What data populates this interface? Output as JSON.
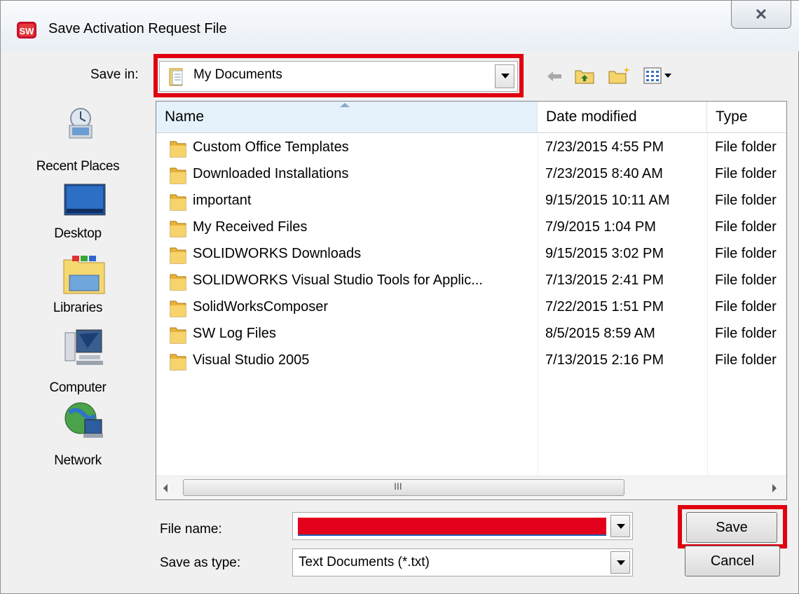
{
  "window": {
    "title": "Save Activation Request File",
    "app_icon": "solidworks-icon",
    "close_glyph": "✕"
  },
  "save_in": {
    "label": "Save in:",
    "value": "My Documents",
    "icon": "folder-documents-icon"
  },
  "toolbar": {
    "back": "back-arrow-icon",
    "up": "up-folder-icon",
    "new": "new-folder-icon",
    "view": "view-menu-icon"
  },
  "places": [
    {
      "label": "Recent Places",
      "icon": "recent-places-icon"
    },
    {
      "label": "Desktop",
      "icon": "desktop-icon"
    },
    {
      "label": "Libraries",
      "icon": "libraries-icon"
    },
    {
      "label": "Computer",
      "icon": "computer-icon"
    },
    {
      "label": "Network",
      "icon": "network-icon"
    }
  ],
  "columns": {
    "name": "Name",
    "date": "Date modified",
    "type": "Type"
  },
  "files": [
    {
      "name": "Custom Office Templates",
      "date": "7/23/2015 4:55 PM",
      "type": "File folder"
    },
    {
      "name": "Downloaded Installations",
      "date": "7/23/2015 8:40 AM",
      "type": "File folder"
    },
    {
      "name": "important",
      "date": "9/15/2015 10:11 AM",
      "type": "File folder"
    },
    {
      "name": "My Received Files",
      "date": "7/9/2015 1:04 PM",
      "type": "File folder"
    },
    {
      "name": "SOLIDWORKS Downloads",
      "date": "9/15/2015 3:02 PM",
      "type": "File folder"
    },
    {
      "name": "SOLIDWORKS Visual Studio Tools for Applic...",
      "date": "7/13/2015 2:41 PM",
      "type": "File folder"
    },
    {
      "name": "SolidWorksComposer",
      "date": "7/22/2015 1:51 PM",
      "type": "File folder"
    },
    {
      "name": "SW Log Files",
      "date": "8/5/2015 8:59 AM",
      "type": "File folder"
    },
    {
      "name": "Visual Studio 2005",
      "date": "7/13/2015 2:16 PM",
      "type": "File folder"
    }
  ],
  "scrollbar": {
    "grip": "III"
  },
  "form": {
    "filename_label": "File name:",
    "filename_value": "",
    "filetype_label": "Save as type:",
    "filetype_value": "Text Documents (*.txt)"
  },
  "buttons": {
    "save": "Save",
    "cancel": "Cancel"
  },
  "colors": {
    "highlight": "#e0000f",
    "header_selected": "#e5f1fb",
    "folder": "#e8b33b"
  }
}
